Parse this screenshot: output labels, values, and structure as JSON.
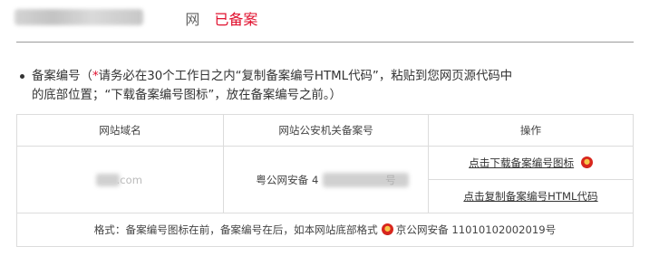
{
  "header": {
    "site_name_suffix": "网",
    "status": "已备案"
  },
  "note": {
    "label": "备案编号（",
    "star": "*",
    "line1_text": " 请务必在30个工作日之内“复制备案编号HTML代码”，粘贴到您网页源代码中",
    "line2_text": "的底部位置；“下载备案编号图标”，放在备案编号之前。）"
  },
  "table": {
    "headers": [
      "网站域名",
      "网站公安机关备案号",
      "操作"
    ],
    "domain_tail": ".com",
    "record_prefix": "粤公网安备 4",
    "record_suffix": "号",
    "download_link": "点击下载备案编号图标",
    "copy_link": "点击复制备案编号HTML代码",
    "format_text_before": "格式：备案编号图标在前，备案编号在后，如本网站底部格式",
    "format_example": "京公网安备 11010102002019号"
  },
  "icons": {
    "emblem": "police-emblem-icon"
  },
  "colors": {
    "accent_red": "#e0102e",
    "divider": "#9a9a9a"
  }
}
